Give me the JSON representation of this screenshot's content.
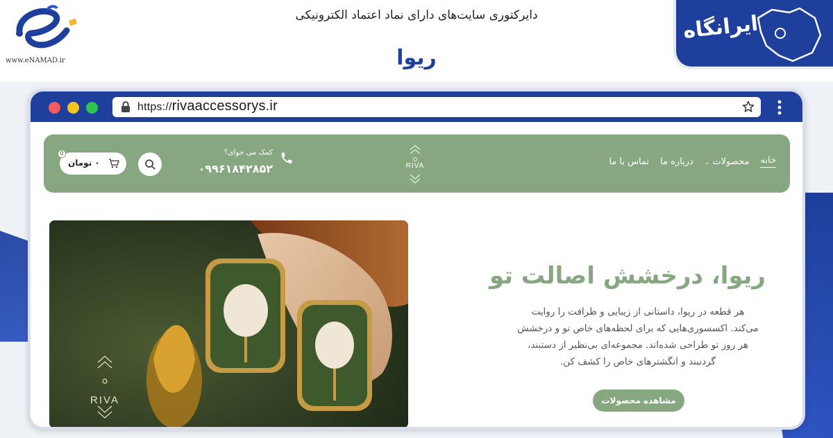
{
  "page": {
    "heading": "دایرکتوری سایت‌های دارای نماد اعتماد الکترونیکی",
    "site_name": "ریوا",
    "enamad_caption": "www.eNAMAD.ir",
    "iranegah_logo_text": "ایرانگاه"
  },
  "browser": {
    "url": "rivaaccessorys.ir",
    "url_prefix": "https://"
  },
  "nav": {
    "links": [
      {
        "label": "خانه",
        "active": true
      },
      {
        "label": "محصولات",
        "has_dropdown": true
      },
      {
        "label": "درباره ما"
      },
      {
        "label": "تماس با ما"
      }
    ],
    "logo_text": "RIVA",
    "help_label": "کمک می خوای؟",
    "phone": "۰۹۹۶۱۸۴۲۸۵۲",
    "cart_total": "۰ تومان",
    "cart_count": "0"
  },
  "hero": {
    "title": "ریوا، درخشش اصالت تو",
    "description": "هر قطعه در ریوا، داستانی از زیبایی و ظرافت را روایت می‌کند. اکسسوری‌هایی که برای لحظه‌های خاص تو و درخشش هر روز تو طراحی شده‌اند. مجموعه‌ای بی‌نظیر از دستبند، گردنبند و انگشترهای خاص را کشف کن.",
    "cta": "مشاهده محصولات",
    "image_logo_text": "RIVA"
  },
  "colors": {
    "brand_green": "#86a780",
    "directory_blue": "#1f3f9c"
  }
}
